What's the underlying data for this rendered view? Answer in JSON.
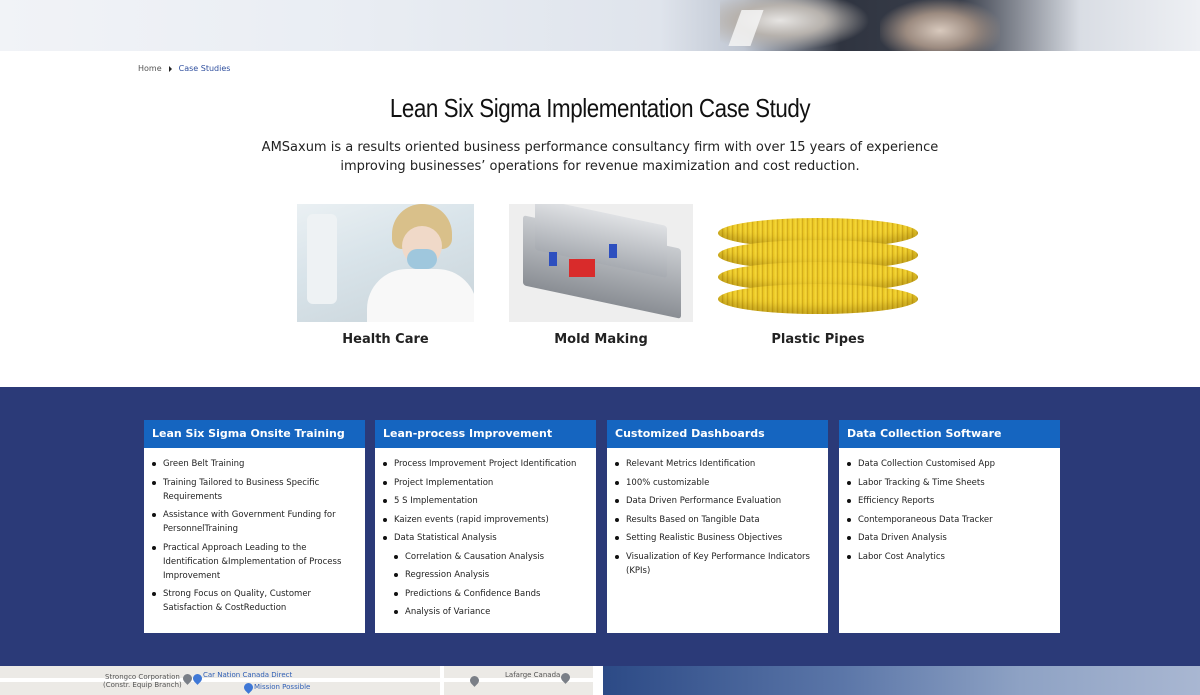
{
  "breadcrumb": {
    "home": "Home",
    "current": "Case Studies"
  },
  "page": {
    "title": "Lean Six Sigma Implementation Case Study",
    "intro": "AMSaxum is a results oriented business performance consultancy firm with over 15 years of experience improving businesses’ operations for revenue maximization and cost reduction."
  },
  "cases": [
    {
      "label": "Health Care"
    },
    {
      "label": "Mold Making"
    },
    {
      "label": "Plastic Pipes"
    }
  ],
  "services": [
    {
      "title": "Lean Six Sigma Onsite Training",
      "items": [
        "Green Belt Training",
        "Training Tailored to Business Specific Requirements",
        "Assistance with Government Funding for PersonnelTraining",
        "Practical Approach Leading to the Identification &Implementation of Process Improvement",
        "Strong Focus on Quality, Customer Satisfaction & CostReduction"
      ]
    },
    {
      "title": "Lean-process Improvement",
      "items": [
        "Process Improvement Project Identification",
        "Project Implementation",
        "5 S Implementation",
        "Kaizen events (rapid improvements)",
        "Data Statistical Analysis"
      ],
      "subitems": [
        "Correlation & Causation Analysis",
        "Regression Analysis",
        "Predictions & Confidence Bands",
        "Analysis of Variance"
      ]
    },
    {
      "title": "Customized Dashboards",
      "items": [
        "Relevant Metrics Identification",
        "100% customizable",
        "Data Driven Performance Evaluation",
        "Results Based on Tangible Data",
        "Setting Realistic Business Objectives",
        "Visualization of Key Performance Indicators (KPIs)"
      ]
    },
    {
      "title": "Data Collection Software",
      "items": [
        "Data Collection Customised App",
        "Labor Tracking & Time Sheets",
        "Efficiency Reports",
        "Contemporaneous Data Tracker",
        "Data Driven Analysis",
        "Labor Cost Analytics"
      ]
    }
  ],
  "map": {
    "labels": [
      "Strongco Corporation",
      "(Constr. Equip Branch)",
      "Car Nation Canada Direct",
      "Mission Possible",
      "Lafarge Canada"
    ]
  },
  "colors": {
    "band": "#2b3a78",
    "card_header": "#1565c0",
    "breadcrumb_link": "#2f4f9e"
  }
}
